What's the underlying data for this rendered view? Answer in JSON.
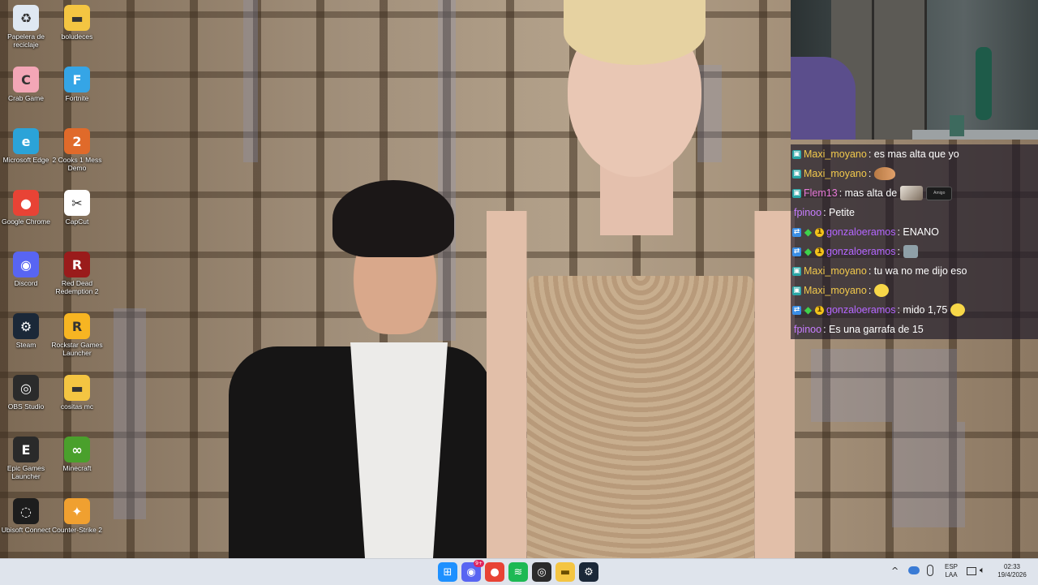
{
  "desktop": {
    "icons": [
      {
        "label": "Papelera de reciclaje",
        "icon": "recycle-bin-icon",
        "color": "#dfe8f2"
      },
      {
        "label": "boludeces",
        "icon": "folder-icon",
        "color": "#f4c542"
      },
      {
        "label": "Crab Game",
        "icon": "crab-game-icon",
        "color": "#f3a6b6"
      },
      {
        "label": "Fortnite",
        "icon": "fortnite-icon",
        "color": "#35a5e6"
      },
      {
        "label": "Microsoft Edge",
        "icon": "edge-icon",
        "color": "#2ba3d8"
      },
      {
        "label": "2 Cooks 1 Mess Demo",
        "icon": "cooks-game-icon",
        "color": "#e06a2a"
      },
      {
        "label": "Google Chrome",
        "icon": "chrome-icon",
        "color": "#e84335"
      },
      {
        "label": "CapCut",
        "icon": "capcut-icon",
        "color": "#ffffff"
      },
      {
        "label": "Discord",
        "icon": "discord-icon",
        "color": "#5865f2"
      },
      {
        "label": "Red Dead Redemption 2",
        "icon": "rdr2-icon",
        "color": "#9a1b1b"
      },
      {
        "label": "Steam",
        "icon": "steam-icon",
        "color": "#1b2838"
      },
      {
        "label": "Rockstar Games Launcher",
        "icon": "rockstar-icon",
        "color": "#f7b522"
      },
      {
        "label": "OBS Studio",
        "icon": "obs-icon",
        "color": "#2b2b2b"
      },
      {
        "label": "cositas mc",
        "icon": "folder-icon",
        "color": "#f4c542"
      },
      {
        "label": "Epic Games Launcher",
        "icon": "epic-games-icon",
        "color": "#2a2a2a"
      },
      {
        "label": "Minecraft",
        "icon": "minecraft-icon",
        "color": "#4aa02c"
      },
      {
        "label": "Ubisoft Connect",
        "icon": "ubisoft-icon",
        "color": "#1d1d1d"
      },
      {
        "label": "Counter-Strike 2",
        "icon": "cs2-icon",
        "color": "#f0a030"
      }
    ]
  },
  "chat": {
    "messages": [
      {
        "badges": [
          "sub"
        ],
        "user": "Maxi_moyano",
        "user_color": "#f2c94c",
        "text": ": es mas alta que yo",
        "emote": null
      },
      {
        "badges": [
          "sub"
        ],
        "user": "Maxi_moyano",
        "user_color": "#f2c94c",
        "text": ":",
        "emote": "cat"
      },
      {
        "badges": [
          "sub"
        ],
        "user": "Flem13",
        "user_color": "#e879d8",
        "text": ": mas alta de",
        "emote": "photo",
        "emote_text": "Amigo"
      },
      {
        "badges": [],
        "user": "fpinoo",
        "user_color": "#c77dff",
        "text": ": Petite",
        "emote": null
      },
      {
        "badges": [
          "share",
          "gem",
          "lvl"
        ],
        "user": "gonzaloeramos",
        "user_color": "#b466ff",
        "text": ": ENANO",
        "emote": null
      },
      {
        "badges": [
          "share",
          "gem",
          "lvl"
        ],
        "user": "gonzaloeramos",
        "user_color": "#b466ff",
        "text": ":",
        "emote": "avatar"
      },
      {
        "badges": [
          "sub"
        ],
        "user": "Maxi_moyano",
        "user_color": "#f2c94c",
        "text": ": tu wa no me dijo eso",
        "emote": null
      },
      {
        "badges": [
          "sub"
        ],
        "user": "Maxi_moyano",
        "user_color": "#f2c94c",
        "text": ":",
        "emote": "face"
      },
      {
        "badges": [
          "share",
          "gem",
          "lvl"
        ],
        "user": "gonzaloeramos",
        "user_color": "#b466ff",
        "text": ": mido 1,75",
        "emote": "face"
      },
      {
        "badges": [],
        "user": "fpinoo",
        "user_color": "#c77dff",
        "text": ": Es una garrafa de 15",
        "emote": null
      }
    ]
  },
  "taskbar": {
    "apps": [
      {
        "name": "windows-start",
        "icon": "windows-icon",
        "color": "#1e90ff"
      },
      {
        "name": "discord",
        "icon": "discord-icon",
        "color": "#5865f2",
        "badge": "9+"
      },
      {
        "name": "chrome",
        "icon": "chrome-icon",
        "color": "#e84335"
      },
      {
        "name": "spotify",
        "icon": "spotify-icon",
        "color": "#1db954"
      },
      {
        "name": "obs",
        "icon": "obs-icon",
        "color": "#2b2b2b"
      },
      {
        "name": "file-explorer",
        "icon": "folder-icon",
        "color": "#f4c542"
      },
      {
        "name": "steam",
        "icon": "steam-icon",
        "color": "#1b2838"
      }
    ],
    "tray": {
      "chevron": "^",
      "lang_line1": "ESP",
      "lang_line2": "LAA",
      "time": "02:33",
      "date": "19/4/2026"
    }
  }
}
